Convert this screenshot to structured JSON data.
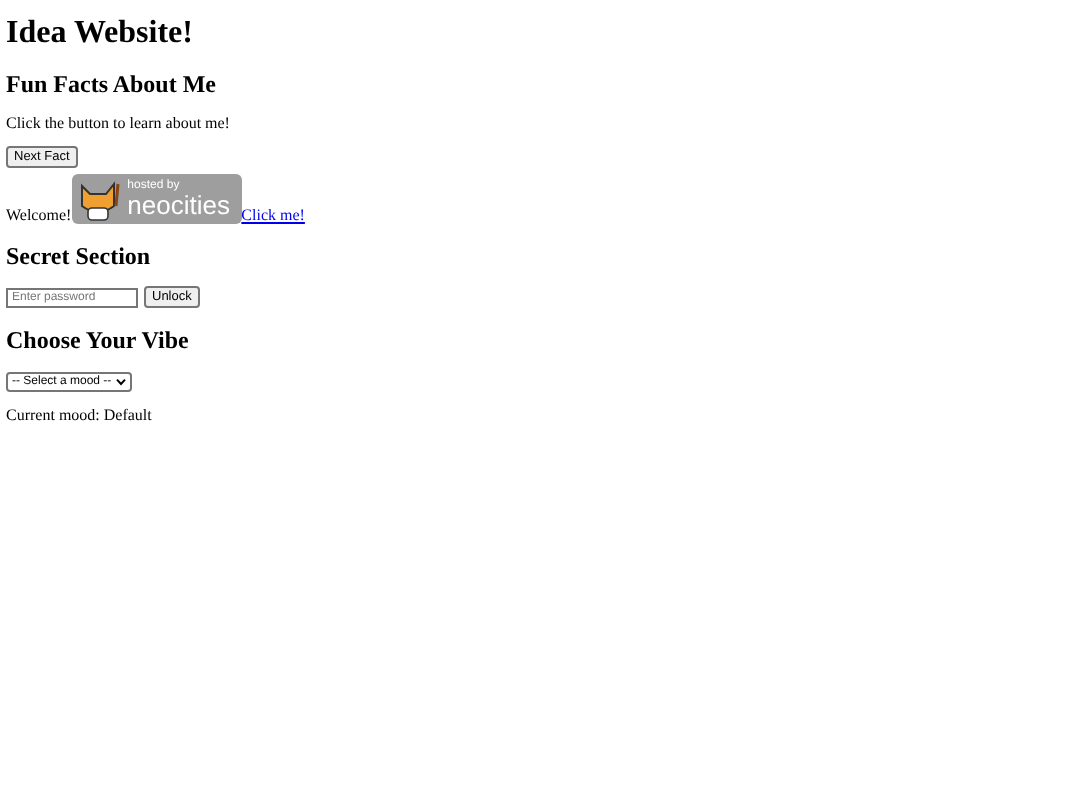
{
  "title": "Idea Website!",
  "facts": {
    "heading": "Fun Facts About Me",
    "text": "Click the button to learn about me!",
    "button": "Next Fact"
  },
  "welcome": {
    "text": "Welcome!",
    "badge_line_1": "hosted by",
    "badge_line_2": "neocities",
    "link": "Click me!"
  },
  "secret": {
    "heading": "Secret Section",
    "placeholder": "Enter password",
    "button": "Unlock"
  },
  "vibe": {
    "heading": "Choose Your Vibe",
    "select": "-- Select a mood --",
    "mood_text": "Current mood: Default"
  }
}
